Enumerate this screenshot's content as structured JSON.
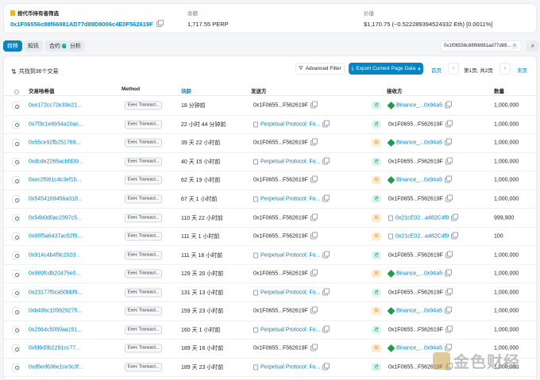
{
  "header": {
    "holder_label": "按代币持有者筛选",
    "holder_address": "0x1F06556c88f66981AD77d89D8006c4E0F562619F",
    "balance_label": "余额",
    "balance_value": "1,717.55 PERP",
    "value_label": "价值",
    "value_value": "$1,170.75 (~0.522289394524332 Eth) [0.0011%]"
  },
  "tabs": [
    {
      "label": "转移"
    },
    {
      "label": "知讯"
    },
    {
      "label": "合约"
    },
    {
      "label": "分析"
    }
  ],
  "filter": {
    "label": "0x1f06556c88f66981ad77d89..."
  },
  "summary": {
    "text": "共找到36个交易"
  },
  "toolbar": {
    "advanced_filter": "Advanced Filter",
    "export": "Export Current Page Data",
    "first": "首页",
    "page": "第1页, 共2页",
    "last": "末页"
  },
  "columns": {
    "hash": "交易哈希值",
    "method": "Method",
    "age": "块龄",
    "from": "发送方",
    "to": "接收方",
    "amount": "数量"
  },
  "rows": [
    {
      "hash": "0xe172cc72e33e21...",
      "method": "Exec Transact...",
      "age": "18 分钟前",
      "from": "0x1F0655...F562619F",
      "dir": "进",
      "to": "Binance_...0x94a5",
      "amount": "1,000,000"
    },
    {
      "hash": "0x7f3c1e6b54a10ac...",
      "method": "Exec Transact...",
      "age": "22 小时 44 分钟前",
      "from": "Perpetual Protocol: Fo...",
      "dir": "进",
      "to": "0x1F0655...F562619F",
      "amount": "1,000,000"
    },
    {
      "hash": "0x55ce92fb251769...",
      "method": "Exec Transact...",
      "age": "39 天 22 小时前",
      "from": "0x1F0655...F562619F",
      "dir": "出",
      "to": "Binance_...0x94a5",
      "amount": "1,000,000"
    },
    {
      "hash": "0xdcde2265acbfd39...",
      "method": "Exec Transact...",
      "age": "40 天 15 小时前",
      "from": "Perpetual Protocol: Fo...",
      "dir": "进",
      "to": "0x1F0655...F562619F",
      "amount": "1,000,000"
    },
    {
      "hash": "0xec2f081c4c3ef1b...",
      "method": "Exec Transact...",
      "age": "62 天 19 小时前",
      "from": "0x1F0655...F562619F",
      "dir": "出",
      "to": "Binance_...0x94a5",
      "amount": "1,000,000"
    },
    {
      "hash": "0x5454169456a318...",
      "method": "Exec Transact...",
      "age": "67 天 1 小时前",
      "from": "Perpetual Protocol: Fo...",
      "dir": "进",
      "to": "0x1F0655...F562619F",
      "amount": "1,000,000"
    },
    {
      "hash": "0x54b0d0ac2397c5...",
      "method": "Exec Transact...",
      "age": "110 天 22 小时前",
      "from": "0x1F0655...F562619F",
      "dir": "出",
      "to": "0x21cE02...a482C4f9",
      "amount": "999,900"
    },
    {
      "hash": "0x95f5a6437ac52f5...",
      "method": "Exec Transact...",
      "age": "111 天 1 小时前",
      "from": "0x1F0655...F562619F",
      "dir": "出",
      "to": "0x21cE02...a482C4f9",
      "amount": "100"
    },
    {
      "hash": "0x914c4b4f9c202d...",
      "method": "Exec Transact...",
      "age": "111 天 18 小时前",
      "from": "Perpetual Protocol: Fo...",
      "dir": "进",
      "to": "0x1F0655...F562619F",
      "amount": "1,000,000"
    },
    {
      "hash": "0x989fcdb20475e0...",
      "method": "Exec Transact...",
      "age": "129 天 20 小时前",
      "from": "0x1F0655...F562619F",
      "dir": "出",
      "to": "Binance_...0x94a5",
      "amount": "1,000,000"
    },
    {
      "hash": "0x23177f0ca50bbf9...",
      "method": "Exec Transact...",
      "age": "131 天 13 小时前",
      "from": "Perpetual Protocol: Fo...",
      "dir": "进",
      "to": "0x1F0655...F562619F",
      "amount": "1,000,000"
    },
    {
      "hash": "0xb49bc109929275...",
      "method": "Exec Transact...",
      "age": "159 天 23 小时前",
      "from": "0x1F0655...F562619F",
      "dir": "出",
      "to": "Binance_...0x94a5",
      "amount": "1,000,000"
    },
    {
      "hash": "0x2564c5050aa151...",
      "method": "Exec Transact...",
      "age": "160 天 1 小时前",
      "from": "Perpetual Protocol: Fo...",
      "dir": "进",
      "to": "0x1F0655...F562619F",
      "amount": "1,000,000"
    },
    {
      "hash": "0xfd6d3b2291cc77...",
      "method": "Exec Transact...",
      "age": "189 天 16 小时前",
      "from": "0x1F0655...F562619F",
      "dir": "出",
      "to": "Binance_...0x94a5",
      "amount": "1,000,000"
    },
    {
      "hash": "0xd5ed636e1ce3c3f...",
      "method": "Exec Transact...",
      "age": "189 天 23 小时前",
      "from": "Perpetual Protocol: Fo...",
      "dir": "进",
      "to": "0x1F0655...F562619F",
      "amount": "1,000,000"
    }
  ],
  "watermark": {
    "text": "金色财经"
  }
}
